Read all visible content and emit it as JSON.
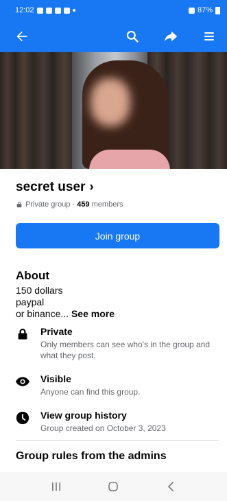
{
  "status_bar": {
    "time": "12:02",
    "battery": "87%"
  },
  "nav": {
    "back_icon": "arrow-left-icon",
    "search_icon": "search-icon",
    "share_icon": "share-icon",
    "menu_icon": "menu-icon"
  },
  "group": {
    "name": "secret user",
    "chevron": "›",
    "privacy": "Private group",
    "separator": " · ",
    "member_count": "459",
    "members_label": " members"
  },
  "join_button": "Join group",
  "about": {
    "heading": "About",
    "line1": "150 dollars",
    "line2": "paypal",
    "line3": "or binance...",
    "see_more": "See more"
  },
  "info_items": [
    {
      "icon": "lock-icon",
      "title": "Private",
      "text": "Only members can see who's in the group and what they post."
    },
    {
      "icon": "eye-icon",
      "title": "Visible",
      "text": "Anyone can find this group."
    },
    {
      "icon": "clock-icon",
      "title": "View group history",
      "text": "Group created on October 3, 2023"
    }
  ],
  "rules_heading": "Group rules from the admins",
  "colors": {
    "brand": "#1877f2",
    "text": "#050505",
    "secondary_text": "#65676b"
  }
}
